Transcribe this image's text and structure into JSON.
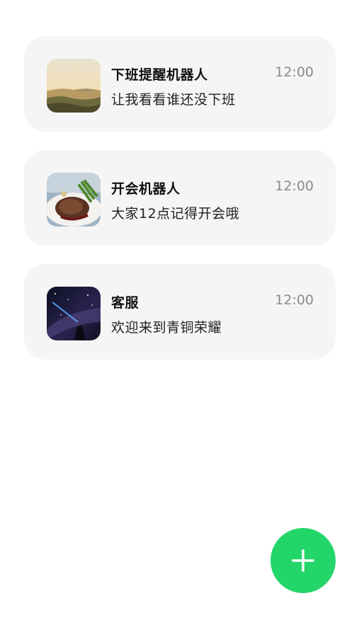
{
  "chats": [
    {
      "name": "下班提醒机器人",
      "time": "12:00",
      "preview": "让我看看谁还没下班",
      "avatar_icon": "landscape-photo"
    },
    {
      "name": "开会机器人",
      "time": "12:00",
      "preview": "大家12点记得开会哦",
      "avatar_icon": "steak-photo"
    },
    {
      "name": "客服",
      "time": "12:00",
      "preview": "欢迎来到青铜荣耀",
      "avatar_icon": "night-sky-photo"
    }
  ],
  "fab": {
    "icon": "plus-icon",
    "color": "#23d66a"
  },
  "colors": {
    "card_background": "#f5f5f5",
    "time_text": "#8a8a8a"
  }
}
